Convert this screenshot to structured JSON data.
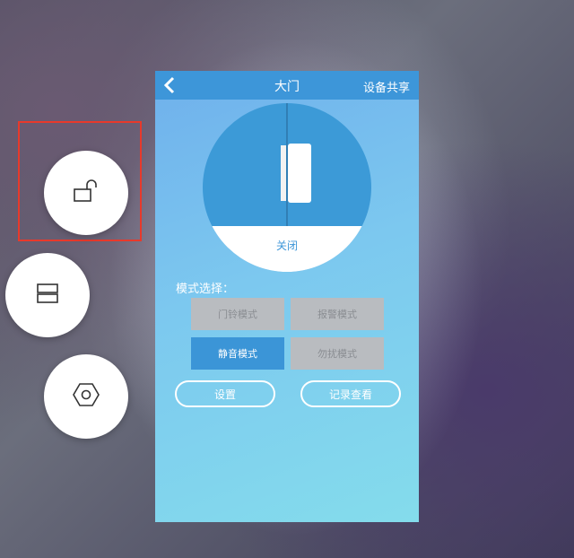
{
  "header": {
    "title": "大门",
    "share_label": "设备共享"
  },
  "door": {
    "status": "关闭"
  },
  "modes": {
    "label": "模式选择：",
    "items": [
      {
        "label": "门铃模式",
        "active": false
      },
      {
        "label": "报警模式",
        "active": false
      },
      {
        "label": "静音模式",
        "active": true
      },
      {
        "label": "勿扰模式",
        "active": false
      }
    ]
  },
  "actions": {
    "settings_label": "设置",
    "records_label": "记录查看"
  },
  "floating_buttons": {
    "items": [
      "unlock-icon",
      "layers-icon",
      "hexagon-settings-icon"
    ]
  },
  "colors": {
    "accent": "#3d96d9",
    "highlight": "#e8392b"
  }
}
